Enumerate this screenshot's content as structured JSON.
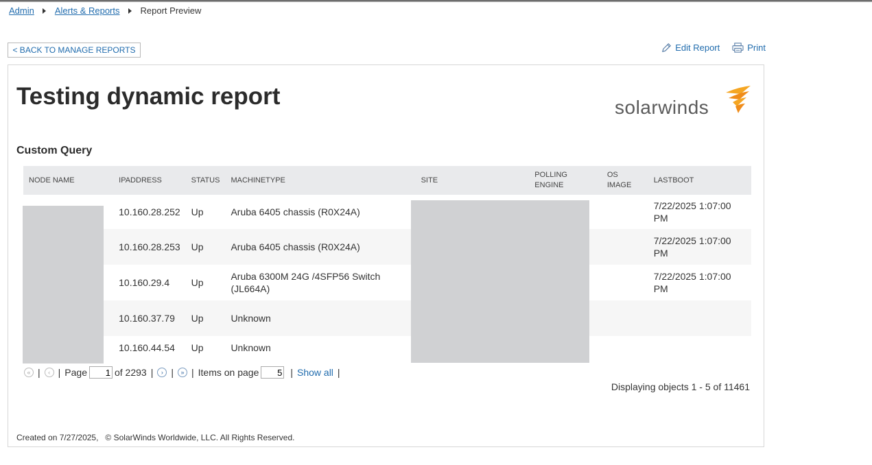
{
  "breadcrumb": {
    "admin": "Admin",
    "alerts": "Alerts & Reports",
    "current": "Report Preview"
  },
  "toolbar": {
    "back_label": "< BACK TO MANAGE REPORTS",
    "edit_label": "Edit Report",
    "print_label": "Print"
  },
  "report": {
    "title": "Testing dynamic report",
    "logo_text": "solarwinds",
    "section_title": "Custom Query",
    "columns": [
      "NODE NAME",
      "IPADDRESS",
      "STATUS",
      "MACHINETYPE",
      "SITE",
      "POLLING ENGINE",
      "OS IMAGE",
      "LASTBOOT"
    ],
    "rows": [
      {
        "node_name": "",
        "ip": "10.160.28.252",
        "status": "Up",
        "machine_type": "Aruba 6405 chassis (R0X24A)",
        "site": "",
        "polling_engine": "",
        "os_image": "",
        "last_boot": "7/22/2025 1:07:00 PM"
      },
      {
        "node_name": "",
        "ip": "10.160.28.253",
        "status": "Up",
        "machine_type": "Aruba 6405 chassis (R0X24A)",
        "site": "",
        "polling_engine": "",
        "os_image": "",
        "last_boot": "7/22/2025 1:07:00 PM"
      },
      {
        "node_name": "",
        "ip": "10.160.29.4",
        "status": "Up",
        "machine_type": "Aruba 6300M 24G /4SFP56 Switch (JL664A)",
        "site": "",
        "polling_engine": "",
        "os_image": "",
        "last_boot": "7/22/2025 1:07:00 PM"
      },
      {
        "node_name": "",
        "ip": "10.160.37.79",
        "status": "Up",
        "machine_type": "Unknown",
        "site": "",
        "polling_engine": "",
        "os_image": "",
        "last_boot": ""
      },
      {
        "node_name": "",
        "ip": "10.160.44.54",
        "status": "Up",
        "machine_type": "Unknown",
        "site": "",
        "polling_engine": "",
        "os_image": "",
        "last_boot": ""
      }
    ]
  },
  "pager": {
    "page_label": "Page",
    "current_page": "1",
    "of_label": "of 2293",
    "items_label": "Items on page",
    "items_value": "5",
    "show_all": "Show all",
    "displaying": "Displaying objects 1 - 5 of 11461"
  },
  "footer": {
    "text": "Created on 7/27/2025,   © SolarWinds Worldwide, LLC. All Rights Reserved."
  },
  "colors": {
    "link": "#1f6bad",
    "logo_orange": "#f5a623",
    "header_bg": "#e9eaec",
    "redaction": "#d0d1d3"
  }
}
